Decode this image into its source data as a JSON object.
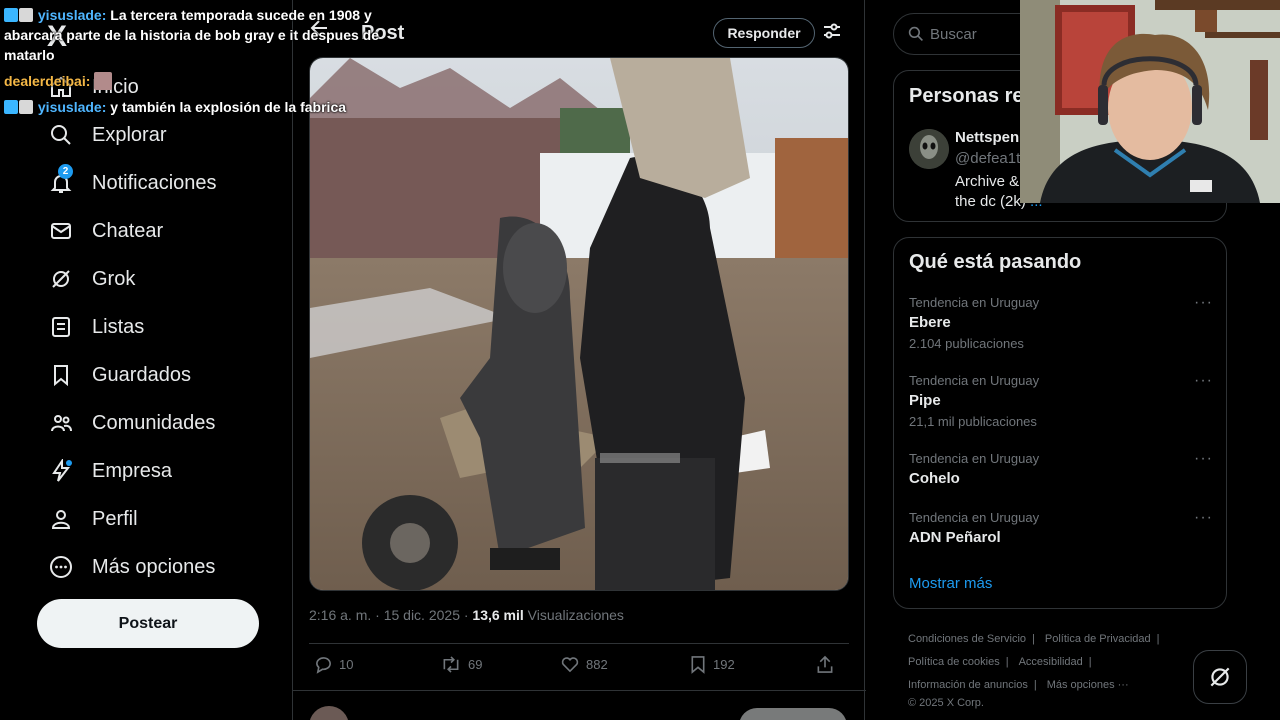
{
  "chat": {
    "lines": [
      {
        "user": "yisuslade:",
        "message": "La tercera temporada sucede en 1908 y abarcara parte de la historia de bob gray e it despues de matarlo"
      },
      {
        "user": "dealerdeibai:",
        "message": ""
      },
      {
        "user": "yisuslade:",
        "message": "y también la explosión de la fabrica"
      }
    ]
  },
  "nav": {
    "logo": "X",
    "items": [
      {
        "label": "Inicio",
        "icon": "home-icon"
      },
      {
        "label": "Explorar",
        "icon": "search-icon"
      },
      {
        "label": "Notificaciones",
        "icon": "bell-icon",
        "badge": "2"
      },
      {
        "label": "Chatear",
        "icon": "mail-icon"
      },
      {
        "label": "Grok",
        "icon": "grok-icon"
      },
      {
        "label": "Listas",
        "icon": "list-icon"
      },
      {
        "label": "Guardados",
        "icon": "bookmark-icon"
      },
      {
        "label": "Comunidades",
        "icon": "people-icon"
      },
      {
        "label": "Empresa",
        "icon": "lightning-icon"
      },
      {
        "label": "Perfil",
        "icon": "person-icon"
      },
      {
        "label": "Más opciones",
        "icon": "more-circle-icon"
      }
    ],
    "post_button": "Postear"
  },
  "topbar": {
    "title": "Post",
    "reply_button": "Responder"
  },
  "post": {
    "time": "2:16 a. m. · 15 dic. 2025 · ",
    "views_count": "13,6 mil",
    "views_label": " Visualizaciones",
    "actions": {
      "replies": "10",
      "reposts": "69",
      "likes": "882",
      "bookmarks": "192"
    }
  },
  "right": {
    "search_placeholder": "Buscar",
    "who_to_follow": {
      "title": "Personas re",
      "name": "Nettspen",
      "handle": "@defea1t",
      "bio": "Archive &",
      "bio2": "the dc (2k)",
      "bio_link": "..."
    },
    "trends": {
      "title": "Qué está pasando",
      "items": [
        {
          "context": "Tendencia en Uruguay",
          "name": "Ebere",
          "count": "2.104 publicaciones"
        },
        {
          "context": "Tendencia en Uruguay",
          "name": "Pipe",
          "count": "21,1 mil publicaciones"
        },
        {
          "context": "Tendencia en Uruguay",
          "name": "Cohelo",
          "count": ""
        },
        {
          "context": "Tendencia en Uruguay",
          "name": "ADN Peñarol",
          "count": ""
        }
      ],
      "show_more": "Mostrar más"
    },
    "footer": {
      "links": [
        "Condiciones de Servicio",
        "Política de Privacidad",
        "Política de cookies",
        "Accesibilidad",
        "Información de anuncios",
        "Más opciones ···"
      ],
      "copyright": "© 2025 X Corp."
    }
  },
  "colors": {
    "accent": "#1d9bf0",
    "background": "#000000",
    "border": "#2f3336",
    "muted": "#71767b"
  }
}
